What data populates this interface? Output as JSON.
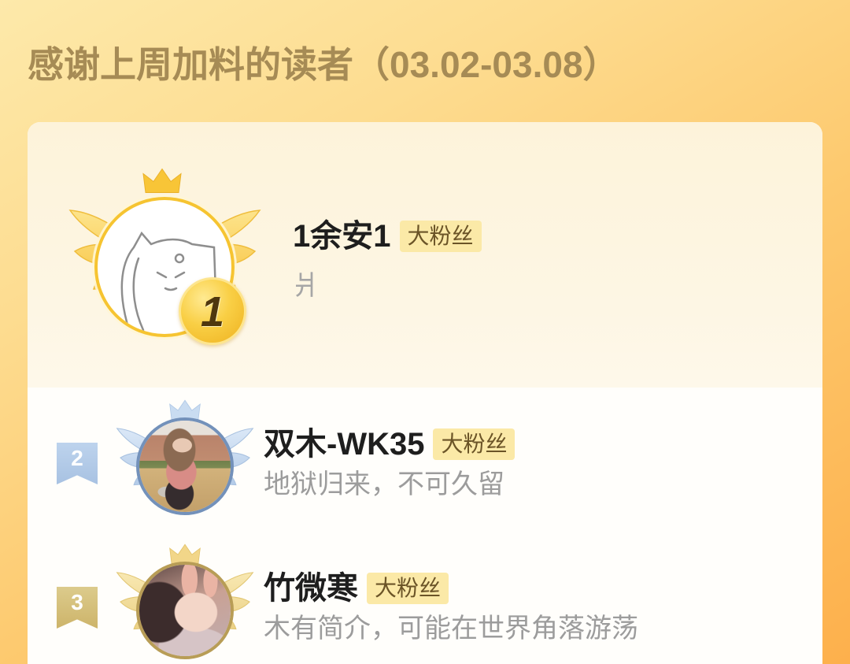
{
  "header": {
    "title": "感谢上周加料的读者（03.02-03.08）"
  },
  "readers": [
    {
      "rank": "1",
      "name": "1余安1",
      "badge": "大粉丝",
      "bio": "爿",
      "rank_icon": "gold-coin-rank-icon",
      "frame_icon": "gold-winged-crown-frame-icon"
    },
    {
      "rank": "2",
      "name": "双木-WK35",
      "badge": "大粉丝",
      "bio": "地狱归来，不可久留",
      "rank_icon": "blue-ribbon-rank-icon",
      "frame_icon": "blue-winged-crown-frame-icon"
    },
    {
      "rank": "3",
      "name": "竹微寒",
      "badge": "大粉丝",
      "bio": "木有简介，可能在世界角落游荡",
      "rank_icon": "bronze-ribbon-rank-icon",
      "frame_icon": "bronze-winged-crown-frame-icon"
    }
  ],
  "colors": {
    "title_text": "#a68b55",
    "badge_bg": "#fbe9a7",
    "badge_text": "#6b5427",
    "rank1_gold": "#f6c431",
    "rank2_blue": "#a8c2e2",
    "rank3_gold": "#cdb46a",
    "bg_top": "#fde9aa",
    "bg_bottom": "#fdb04c"
  }
}
